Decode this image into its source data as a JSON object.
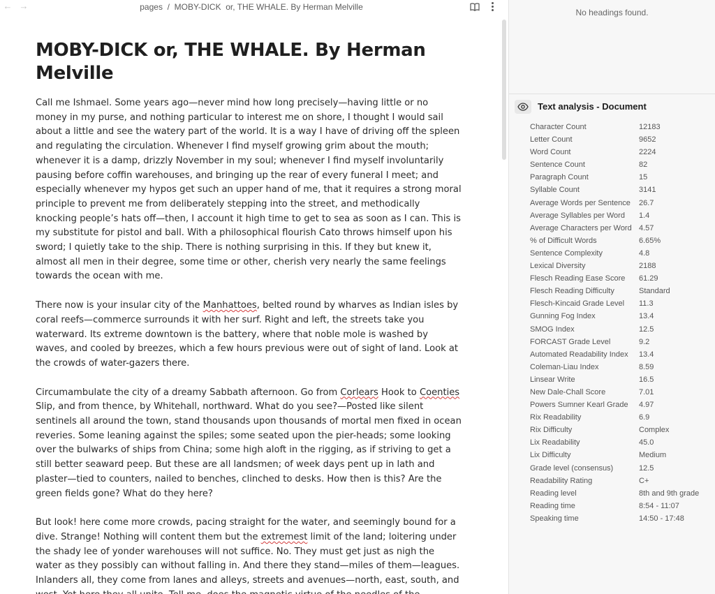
{
  "nav": {
    "back_icon": "arrow-left-icon",
    "forward_icon": "arrow-right-icon",
    "breadcrumb_root": "pages",
    "breadcrumb_sep": "/",
    "breadcrumb_page": "MOBY-DICK  or, THE WHALE. By Herman Melville",
    "reading_icon": "book-open-icon",
    "more_icon": "more-vertical-icon"
  },
  "document": {
    "title": "MOBY-DICK or, THE WHALE. By Herman Melville",
    "paragraphs": [
      {
        "segments": [
          {
            "text": "Call me Ishmael. Some years ago—never mind how long precisely—having little or no money in my purse, and nothing particular to interest me on shore, I thought I would sail about a little and see the watery part of the world. It is a way I have of driving off the spleen and regulating the circulation. Whenever I find myself growing grim about the mouth; whenever it is a damp, drizzly November in my soul; whenever I find myself involuntarily pausing before coffin warehouses, and bringing up the rear of every funeral I meet; and especially whenever my hypos get such an upper hand of me, that it requires a strong moral principle to prevent me from deliberately stepping into the street, and methodically knocking people’s hats off—then, I account it high time to get to sea as soon as I can. This is my substitute for pistol and ball. With a philosophical flourish Cato throws himself upon his sword; I quietly take to the ship. There is nothing surprising in this. If they but knew it, almost all men in their degree, some time or other, cherish very nearly the same feelings towards the ocean with me.",
            "flag": false
          }
        ]
      },
      {
        "segments": [
          {
            "text": "There now is your insular city of the ",
            "flag": false
          },
          {
            "text": "Manhattoes",
            "flag": true
          },
          {
            "text": ", belted round by wharves as Indian isles by coral reefs—commerce surrounds it with her surf. Right and left, the streets take you waterward. Its extreme downtown is the battery, where that noble mole is washed by waves, and cooled by breezes, which a few hours previous were out of sight of land. Look at the crowds of water-gazers there.",
            "flag": false
          }
        ]
      },
      {
        "segments": [
          {
            "text": "Circumambulate the city of a dreamy Sabbath afternoon. Go from ",
            "flag": false
          },
          {
            "text": "Corlears",
            "flag": true
          },
          {
            "text": " Hook to ",
            "flag": false
          },
          {
            "text": "Coenties",
            "flag": true
          },
          {
            "text": " Slip, and from thence, by Whitehall, northward. What do you see?—Posted like silent sentinels all around the town, stand thousands upon thousands of mortal men fixed in ocean reveries. Some leaning against the spiles; some seated upon the pier-heads; some looking over the bulwarks of ships from China; some high aloft in the rigging, as if striving to get a still better seaward peep. But these are all landsmen; of week days pent up in lath and plaster—tied to counters, nailed to benches, clinched to desks. How then is this? Are the green fields gone? What do they here?",
            "flag": false
          }
        ]
      },
      {
        "segments": [
          {
            "text": "But look! here come more crowds, pacing straight for the water, and seemingly bound for a dive. Strange! Nothing will content them but the ",
            "flag": false
          },
          {
            "text": "extremest",
            "flag": true
          },
          {
            "text": " limit of the land; loitering under the shady lee of yonder warehouses will not suffice. No. They must get just as nigh the water as they possibly can without falling in. And there they stand—miles of them—leagues. Inlanders all, they come from lanes and alleys, streets and avenues—north, east, south, and west. Yet here they all unite. Tell me, does the magnetic virtue of the needles of the compasses of all those ships attract them thither?",
            "flag": false
          }
        ]
      }
    ]
  },
  "outline": {
    "empty_text": "No headings found."
  },
  "analysis": {
    "toggle_icon": "eye-icon",
    "title": "Text analysis - Document",
    "stats": [
      {
        "label": "Character Count",
        "value": "12183"
      },
      {
        "label": "Letter Count",
        "value": "9652"
      },
      {
        "label": "Word Count",
        "value": "2224"
      },
      {
        "label": "Sentence Count",
        "value": "82"
      },
      {
        "label": "Paragraph Count",
        "value": "15"
      },
      {
        "label": "Syllable Count",
        "value": "3141"
      },
      {
        "label": "Average Words per Sentence",
        "value": "26.7"
      },
      {
        "label": "Average Syllables per Word",
        "value": "1.4"
      },
      {
        "label": "Average Characters per Word",
        "value": "4.57"
      },
      {
        "label": "% of Difficult Words",
        "value": "6.65%"
      },
      {
        "label": "Sentence Complexity",
        "value": "4.8"
      },
      {
        "label": "Lexical Diversity",
        "value": "2188"
      },
      {
        "label": "Flesch Reading Ease Score",
        "value": "61.29"
      },
      {
        "label": "Flesch Reading Difficulty",
        "value": "Standard"
      },
      {
        "label": "Flesch-Kincaid Grade Level",
        "value": "11.3"
      },
      {
        "label": "Gunning Fog Index",
        "value": "13.4"
      },
      {
        "label": "SMOG Index",
        "value": "12.5"
      },
      {
        "label": "FORCAST Grade Level",
        "value": "9.2"
      },
      {
        "label": "Automated Readability Index",
        "value": "13.4"
      },
      {
        "label": "Coleman-Liau Index",
        "value": "8.59"
      },
      {
        "label": "Linsear Write",
        "value": "16.5"
      },
      {
        "label": "New Dale-Chall Score",
        "value": "7.01"
      },
      {
        "label": "Powers Sumner Kearl Grade",
        "value": "4.97"
      },
      {
        "label": "Rix Readability",
        "value": "6.9"
      },
      {
        "label": "Rix Difficulty",
        "value": "Complex"
      },
      {
        "label": "Lix Readability",
        "value": "45.0"
      },
      {
        "label": "Lix Difficulty",
        "value": "Medium"
      },
      {
        "label": "Grade level (consensus)",
        "value": "12.5"
      },
      {
        "label": "Readability Rating",
        "value": "C+"
      },
      {
        "label": "Reading level",
        "value": "8th and 9th grade"
      },
      {
        "label": "Reading time",
        "value": "8:54 - 11:07"
      },
      {
        "label": "Speaking time",
        "value": "14:50 - 17:48"
      }
    ]
  },
  "colors": {
    "spellcheck_underline": "#d23b3b",
    "panel_background": "#f7f7f7",
    "text": "#2b2b2b"
  }
}
